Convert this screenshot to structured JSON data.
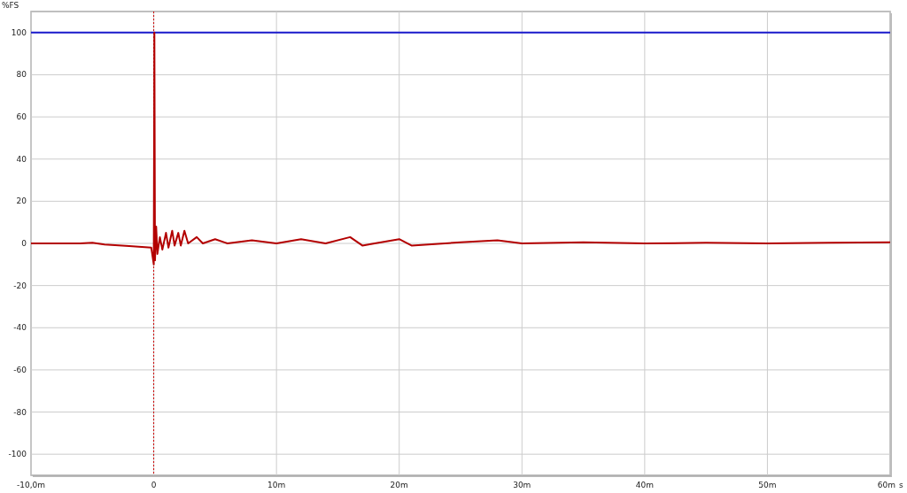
{
  "chart": {
    "chart_data": {
      "type": "line",
      "ylabel": "%FS",
      "xlabel": "s",
      "grid": true,
      "xlim": [
        -10,
        60
      ],
      "ylim": [
        -110,
        110
      ],
      "xticks": [
        {
          "value": -10,
          "label": "-10,0m"
        },
        {
          "value": 0,
          "label": "0"
        },
        {
          "value": 10,
          "label": "10m"
        },
        {
          "value": 20,
          "label": "20m"
        },
        {
          "value": 30,
          "label": "30m"
        },
        {
          "value": 40,
          "label": "40m"
        },
        {
          "value": 50,
          "label": "50m"
        },
        {
          "value": 60,
          "label": "60m"
        }
      ],
      "yticks": [
        -100,
        -80,
        -60,
        -40,
        -20,
        0,
        20,
        40,
        60,
        80,
        100
      ],
      "series": [
        {
          "color": "#1a1acc",
          "x": [
            -10,
            60
          ],
          "values": [
            100,
            100
          ]
        },
        {
          "color": "#b30000",
          "x": [
            -10,
            -6,
            -5,
            -4,
            -2,
            -0.2,
            0,
            0.05,
            0.1,
            0.2,
            0.3,
            0.5,
            0.7,
            1,
            1.2,
            1.5,
            1.7,
            2,
            2.2,
            2.5,
            2.8,
            3.5,
            4,
            5,
            6,
            8,
            10,
            12,
            14,
            16,
            17,
            18,
            20,
            21,
            25,
            28,
            30,
            35,
            40,
            45,
            50,
            55,
            60
          ],
          "values": [
            0,
            0,
            0.3,
            -0.5,
            -1.2,
            -2,
            -10,
            100,
            -8,
            8,
            -5,
            3,
            -3,
            5,
            -2,
            6,
            -1,
            5,
            -1,
            6,
            0,
            3,
            0,
            2,
            0,
            1.5,
            0,
            2,
            0,
            3,
            -1,
            0,
            2,
            -1,
            0.5,
            1.5,
            0,
            0.5,
            0,
            0.3,
            0,
            0.3,
            0.5
          ]
        }
      ],
      "ref_lines": [
        {
          "axis": "x",
          "value": 0,
          "color": "#cc0000"
        }
      ]
    }
  }
}
